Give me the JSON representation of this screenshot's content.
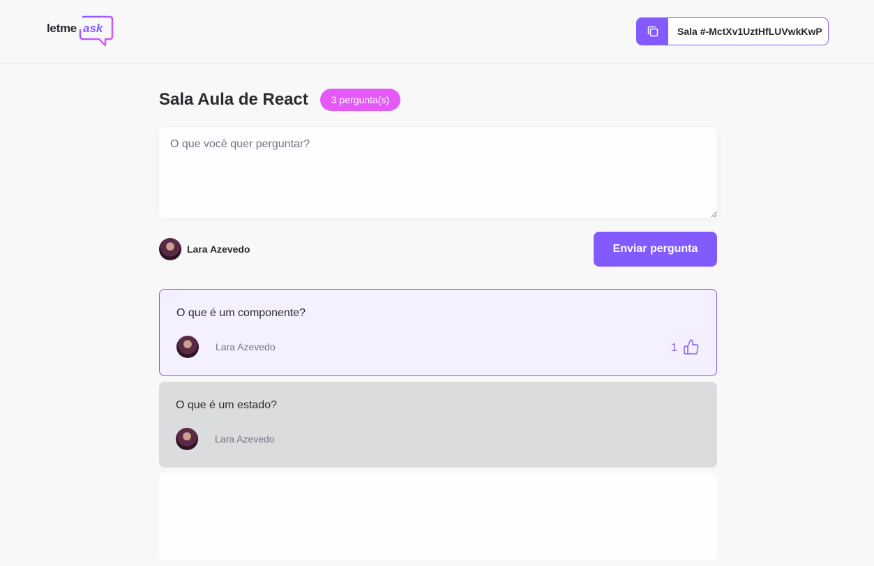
{
  "header": {
    "logo": {
      "text_1": "letme",
      "text_2": "ask"
    },
    "room_code": {
      "label": "Sala #-MctXv1UztHfLUVwkKwP",
      "icon": "copy-icon"
    }
  },
  "room": {
    "title": "Sala Aula de React",
    "question_count": "3 pergunta(s)"
  },
  "form": {
    "placeholder": "O que você quer perguntar?",
    "value": "",
    "user_name": "Lara Azevedo",
    "submit_label": "Enviar pergunta"
  },
  "questions": [
    {
      "content": "O que é um componente?",
      "author": "Lara Azevedo",
      "likes": "1",
      "state": "highlighted"
    },
    {
      "content": "O que é um estado?",
      "author": "Lara Azevedo",
      "likes": "",
      "state": "answered"
    },
    {
      "content": "",
      "author": "",
      "likes": "",
      "state": "plain"
    }
  ],
  "colors": {
    "accent": "#835afd",
    "badge": "#e559f9",
    "background": "#f8f8f8",
    "highlight_bg": "#f4f0ff",
    "answered_bg": "#dbdcdd"
  }
}
